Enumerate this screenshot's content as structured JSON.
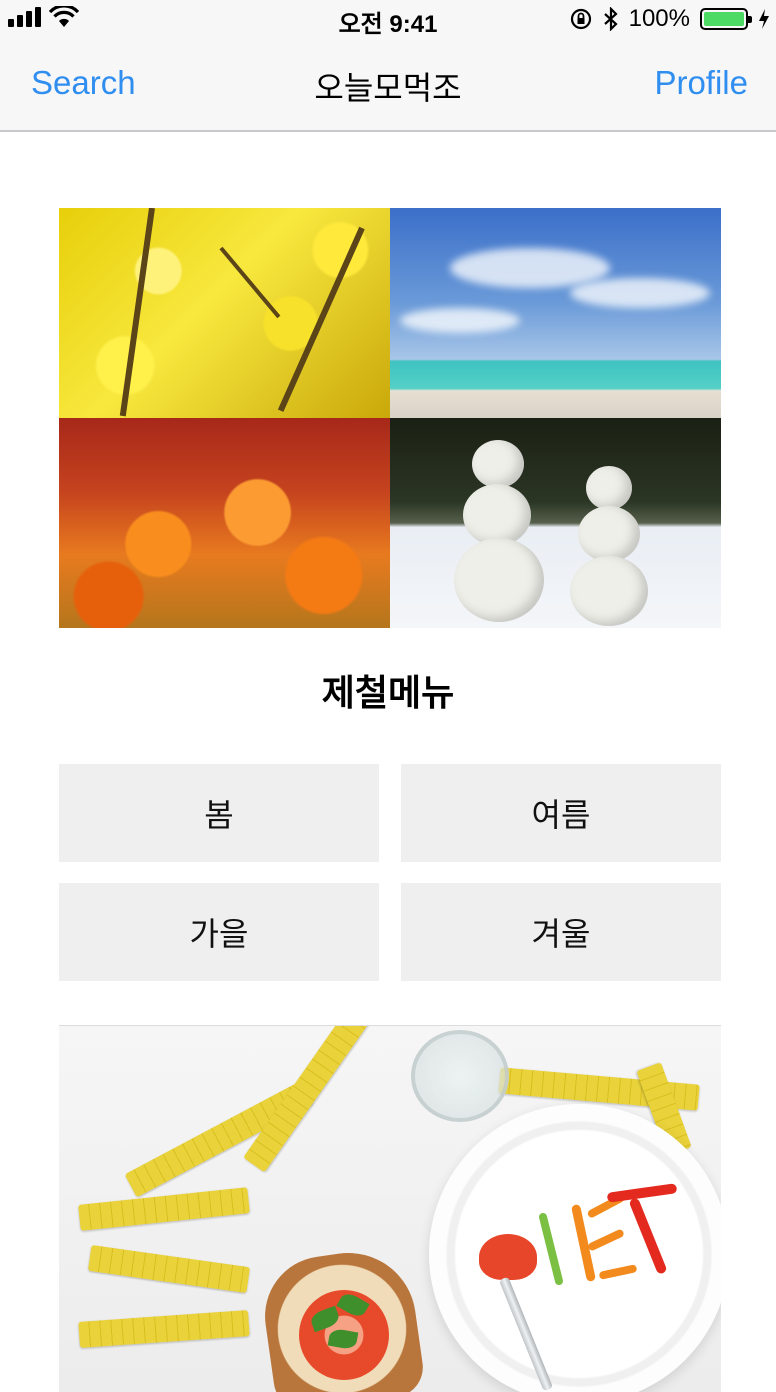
{
  "status_bar": {
    "time": "오전 9:41",
    "battery_percent": "100%",
    "battery_level": 1.0,
    "icons": [
      "signal-icon",
      "wifi-icon",
      "rotation-lock-icon",
      "bluetooth-icon",
      "battery-icon",
      "charging-icon"
    ]
  },
  "nav": {
    "left_button": "Search",
    "title": "오늘모먹조",
    "right_button": "Profile",
    "accent_color": "#2f8ef0"
  },
  "season_images": [
    "spring-forsythia",
    "summer-beach",
    "autumn-maple",
    "winter-snowmen"
  ],
  "section": {
    "title": "제철메뉴"
  },
  "season_buttons": {
    "spring": "봄",
    "summer": "여름",
    "autumn": "가을",
    "winter": "겨울"
  },
  "banner": {
    "alt": "diet-banner-image"
  }
}
